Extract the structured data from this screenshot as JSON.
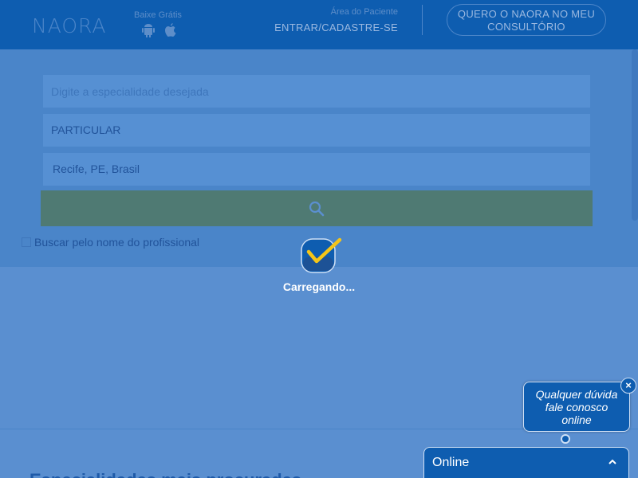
{
  "header": {
    "logo_text": "NAORA",
    "download_label": "Baixe Grátis",
    "patient_area_label": "Área do Paciente",
    "login_link": "ENTRAR/CADASTRE-SE",
    "cta_line1": "QUERO O NAORA NO MEU",
    "cta_line2": "CONSULTÓRIO",
    "icons": [
      "android-icon",
      "apple-icon"
    ]
  },
  "search": {
    "specialty_placeholder": "Digite a especialidade desejada",
    "insurance_value": "PARTICULAR",
    "location_value": "Recife, PE, Brasil",
    "search_icon": "search-icon",
    "checkbox_label": "Buscar pelo nome do profissional"
  },
  "loader": {
    "text": "Carregando..."
  },
  "chat": {
    "bubble_line1": "Qualquer dúvida",
    "bubble_line2": "fale conosco",
    "bubble_line3": "online",
    "close_label": "×",
    "status_label": "Online"
  },
  "colors": {
    "header_bg": "#0e5db0",
    "overlay_bg": "#5a8fd0",
    "search_button": "#4f7a73",
    "check_yellow": "#f5c518"
  }
}
